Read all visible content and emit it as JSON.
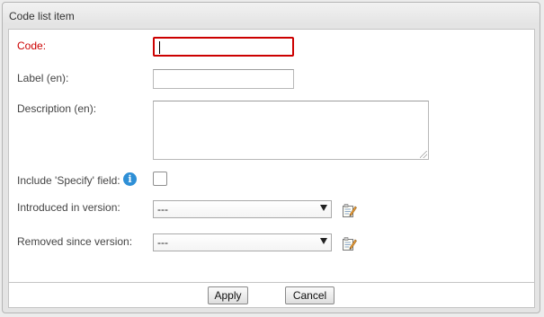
{
  "dialog": {
    "title": "Code list item"
  },
  "form": {
    "code": {
      "label": "Code:",
      "value": ""
    },
    "label_en": {
      "label": "Label (en):",
      "value": ""
    },
    "description_en": {
      "label": "Description (en):",
      "value": ""
    },
    "include_specify": {
      "label": "Include 'Specify' field:",
      "info_icon": "i",
      "checked": false
    },
    "introduced_in_version": {
      "label": "Introduced in version:",
      "selected": "---"
    },
    "removed_since_version": {
      "label": "Removed since version:",
      "selected": "---"
    }
  },
  "footer": {
    "apply_label": "Apply",
    "cancel_label": "Cancel"
  },
  "colors": {
    "required_label": "#cc0000",
    "info_icon": "#2e8fd6"
  },
  "icons": {
    "info": "info-icon",
    "edit_versions": "edit-icon",
    "select_arrow": "chevron-down-icon"
  }
}
